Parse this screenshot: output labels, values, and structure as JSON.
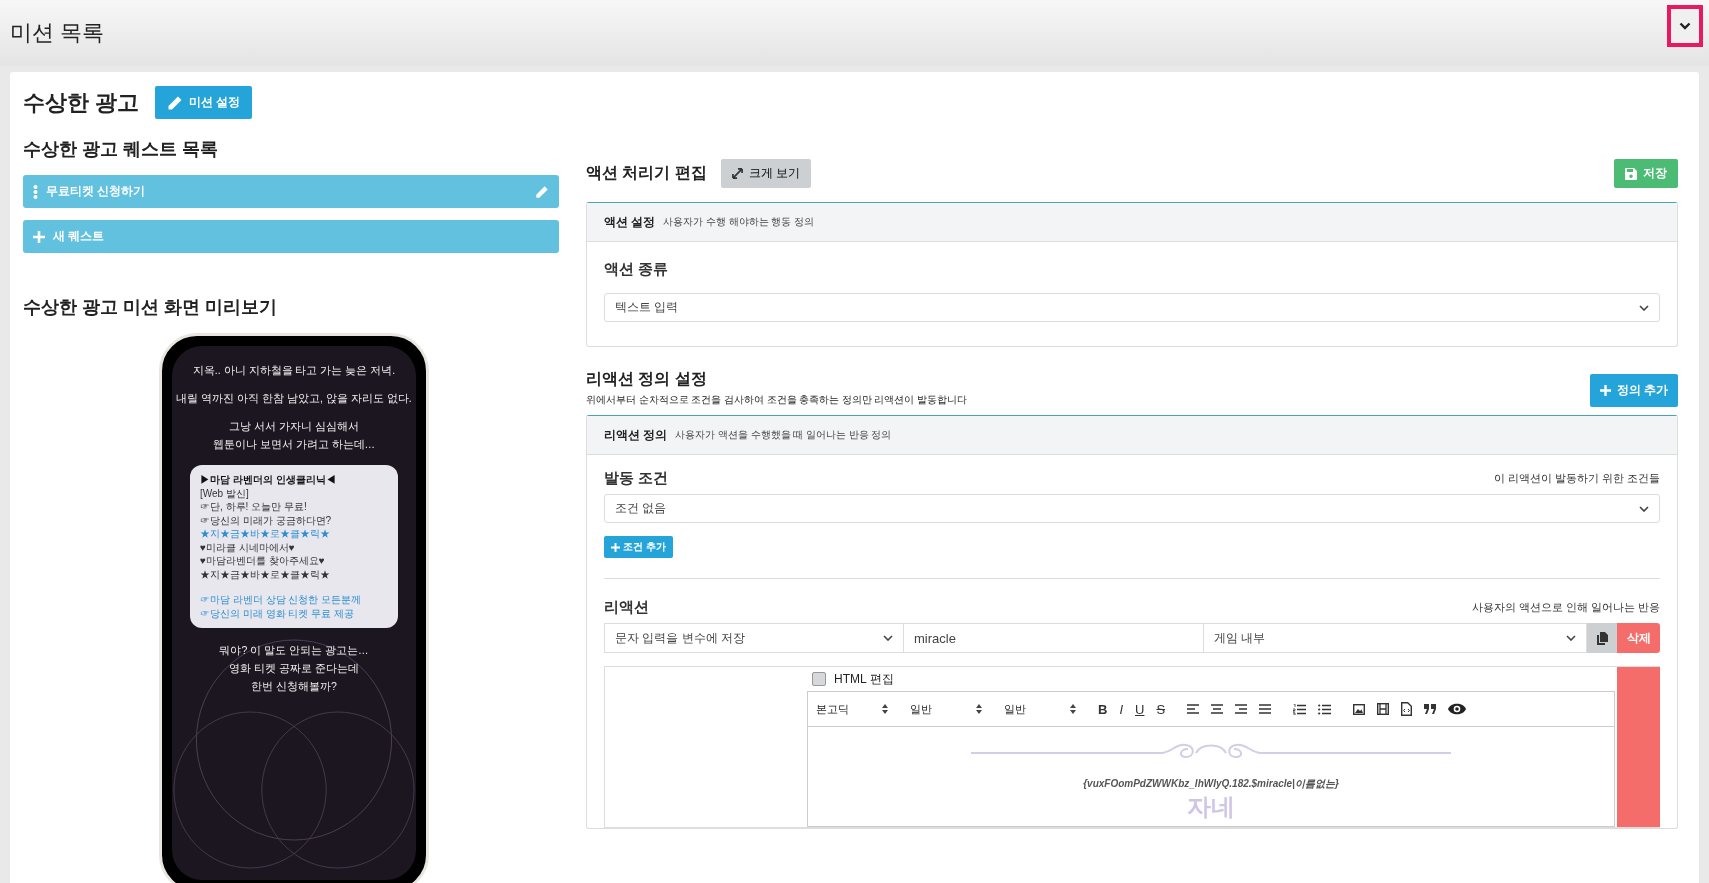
{
  "header": {
    "title": "미션 목록"
  },
  "mission": {
    "title": "수상한 광고",
    "settings_button": "미션 설정"
  },
  "quest_list": {
    "title": "수상한 광고 퀘스트 목록",
    "quests": [
      {
        "label": "무료티켓 신청하기"
      }
    ],
    "new_quest_button": "새 퀘스트"
  },
  "preview": {
    "title": "수상한 광고 미션 화면 미리보기",
    "narration_top": [
      "지옥.. 아니 지하철을 타고 가는 늦은 저녁.",
      "내릴 역까진 아직 한참 남았고, 앉을 자리도 없다.",
      "그낭 서서 가자니 심심해서\n웹툰이나 보면서 가려고 하는데…"
    ],
    "message": [
      {
        "text": "▶마담 라벤더의 인생클리닉◀",
        "kind": "bold"
      },
      {
        "text": "[Web 발신]",
        "kind": "plain"
      },
      {
        "text": "☞단, 하루! 오늘만 무료!",
        "kind": "plain"
      },
      {
        "text": "☞당신의 미래가 궁금하다면?",
        "kind": "plain"
      },
      {
        "text": "★지★금★바★로★클★릭★",
        "kind": "link"
      },
      {
        "text": "♥미라클 시네마에서♥",
        "kind": "plain"
      },
      {
        "text": "♥마담라벤더를 찾아주세요♥",
        "kind": "plain"
      },
      {
        "text": "★지★금★바★로★클★릭★",
        "kind": "plain"
      },
      {
        "text": "☞마담 라벤더 상담 신청한 모든분께",
        "kind": "gap-link"
      },
      {
        "text": "☞당신의 미래 영화 티켓 무료 제공",
        "kind": "link"
      }
    ],
    "narration_bottom": [
      "뭐야? 이 말도 안되는 광고는…\n영화 티켓 공짜로 준다는데\n한번 신청해볼까?"
    ]
  },
  "editor": {
    "title": "액션 처리기 편집",
    "zoom_button": "크게 보기",
    "save_button": "저장",
    "action_panel": {
      "title": "액션 설정",
      "subtitle": "사용자가 수행 해야하는 행동 정의",
      "field_label": "액션 종류",
      "action_type": "텍스트 입력"
    },
    "reaction_section": {
      "title": "리액션 정의 설정",
      "description": "위에서부터 순차적으로 조건을 검사하여 조건을 충족하는 정의만 리액션이 발동합니다",
      "add_button": "정의 추가"
    },
    "reaction_panel": {
      "title": "리액션 정의",
      "subtitle": "사용자가 액션을 수행했을 때 일어나는 반응 정의",
      "trigger_label": "발동 조건",
      "trigger_hint": "이 리액션이 발동하기 위한 조건들",
      "trigger_value": "조건 없음",
      "add_condition_button": "조건 추가",
      "reaction_label": "리액션",
      "reaction_hint": "사용자의 액션으로 인해 일어나는 반응",
      "reaction_type": "문자 입력을 변수에 저장",
      "variable": "miracle",
      "target": "게임 내부",
      "delete_button": "삭제",
      "html_edit": {
        "label": "HTML 편집",
        "checked": false
      },
      "toolbar_selects": [
        "본고딕",
        "일반",
        "일반"
      ],
      "format_buttons": [
        {
          "text": "B",
          "kind": "bold"
        },
        {
          "text": "I",
          "kind": "italic"
        },
        {
          "text": "U",
          "kind": "underline"
        },
        {
          "text": "S",
          "kind": "strike"
        }
      ],
      "content_code": "{vuxFOomPdZWWKbz_lhWIyQ.182.$miracle|이름없는}",
      "content_heading": "자네"
    }
  }
}
